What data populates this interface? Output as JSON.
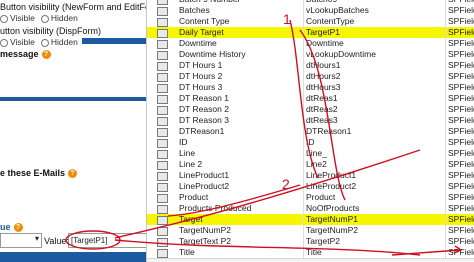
{
  "left_panel": {
    "line1": "Button visibility (NewForm and EditForm)",
    "radio1": [
      "Visible",
      "Hidden"
    ],
    "line2": "utton visibility (DispForm)",
    "radio2": [
      "Visible",
      "Hidden"
    ],
    "line3": "message",
    "line4": "e these E-Mails",
    "select_label": "ue",
    "value_label": "Value:",
    "value_text": "[TargetP1]"
  },
  "table": {
    "rows": [
      {
        "name": "Batch 9 Number",
        "static": "Batch09",
        "type": "SPFieldText",
        "hl": ""
      },
      {
        "name": "Batches",
        "static": "vLookupBatches",
        "type": "SPFieldLo",
        "hl": ""
      },
      {
        "name": "Content Type",
        "static": "ContentType",
        "type": "SPFieldCo",
        "hl": ""
      },
      {
        "name": "Daily Target",
        "static": "TargetP1",
        "type": "SPFieldText",
        "hl": "strong"
      },
      {
        "name": "Downtime",
        "static": "Downtime",
        "type": "SPFieldNu",
        "hl": ""
      },
      {
        "name": "Downtime History",
        "static": "vLookupDowntime",
        "type": "SPFieldLo",
        "hl": ""
      },
      {
        "name": "DT Hours 1",
        "static": "dtHours1",
        "type": "SPFieldNu",
        "hl": ""
      },
      {
        "name": "DT Hours 2",
        "static": "dtHours2",
        "type": "SPFieldNu",
        "hl": ""
      },
      {
        "name": "DT Hours 3",
        "static": "dtHours3",
        "type": "SPFieldNu",
        "hl": ""
      },
      {
        "name": "DT Reason 1",
        "static": "dtReas1",
        "type": "SPFieldCh",
        "hl": ""
      },
      {
        "name": "DT Reason 2",
        "static": "dtReas2",
        "type": "SPFieldCh",
        "hl": ""
      },
      {
        "name": "DT Reason 3",
        "static": "dtReas3",
        "type": "SPFieldCh",
        "hl": ""
      },
      {
        "name": "DTReason1",
        "static": "DTReason1",
        "type": "SPFieldCh",
        "hl": ""
      },
      {
        "name": "ID",
        "static": "ID",
        "type": "SPFieldCo",
        "hl": ""
      },
      {
        "name": "Line",
        "static": "Line_",
        "type": "SPFieldCh",
        "hl": ""
      },
      {
        "name": "Line 2",
        "static": "Line2",
        "type": "SPFieldCh",
        "hl": ""
      },
      {
        "name": "LineProduct1",
        "static": "LineProduct1",
        "type": "SPFieldCh",
        "hl": ""
      },
      {
        "name": "LineProduct2",
        "static": "LineProduct2",
        "type": "SPFieldCh",
        "hl": ""
      },
      {
        "name": "Product",
        "static": "Product",
        "type": "SPFieldCh",
        "hl": ""
      },
      {
        "name": "Products Produced",
        "static": "NoOfProducts",
        "type": "SPFieldNu",
        "hl": ""
      },
      {
        "name": "Target",
        "static": "TargetNumP1",
        "type": "SPFieldNu",
        "hl": "strong"
      },
      {
        "name": "TargetNumP2",
        "static": "TargetNumP2",
        "type": "SPFieldNu",
        "hl": ""
      },
      {
        "name": "TargetText P2",
        "static": "TargetP2",
        "type": "SPFieldTe",
        "hl": ""
      },
      {
        "name": "Title",
        "static": "Title",
        "type": "SPFieldTe",
        "hl": ""
      }
    ]
  },
  "annotations": {
    "label1": "1",
    "label2": "2",
    "color": "#d01020"
  }
}
